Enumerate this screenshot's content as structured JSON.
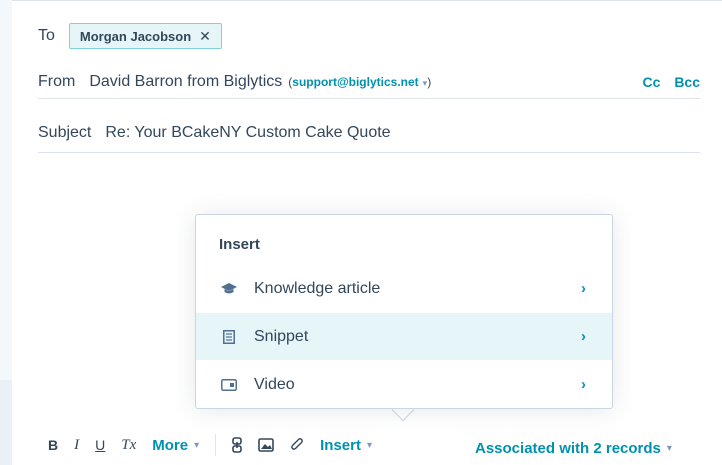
{
  "colors": {
    "accent": "#0091ae",
    "text": "#33475b",
    "chip_bg": "#e5f5f8",
    "active_row": "#e5f5f8"
  },
  "to": {
    "label": "To",
    "recipient": "Morgan Jacobson",
    "remove_glyph": "✕"
  },
  "from": {
    "label": "From",
    "name": "David Barron from Biglytics",
    "email_open": "(",
    "email": "support@biglytics.net",
    "email_close": ")",
    "caret": "▾",
    "cc": "Cc",
    "bcc": "Bcc"
  },
  "subject": {
    "label": "Subject",
    "value": "Re: Your BCakeNY Custom Cake Quote"
  },
  "insert_menu": {
    "header": "Insert",
    "items": [
      {
        "label": "Knowledge article",
        "icon": "graduation-cap-icon",
        "chevron": "›"
      },
      {
        "label": "Snippet",
        "icon": "document-icon",
        "chevron": "›"
      },
      {
        "label": "Video",
        "icon": "video-icon",
        "chevron": "›"
      }
    ]
  },
  "toolbar": {
    "bold": "B",
    "italic": "I",
    "underline": "U",
    "clear_format": "Tx",
    "more": "More",
    "insert": "Insert",
    "caret": "▾"
  },
  "associated": {
    "label": "Associated with 2 records",
    "caret": "▾"
  }
}
